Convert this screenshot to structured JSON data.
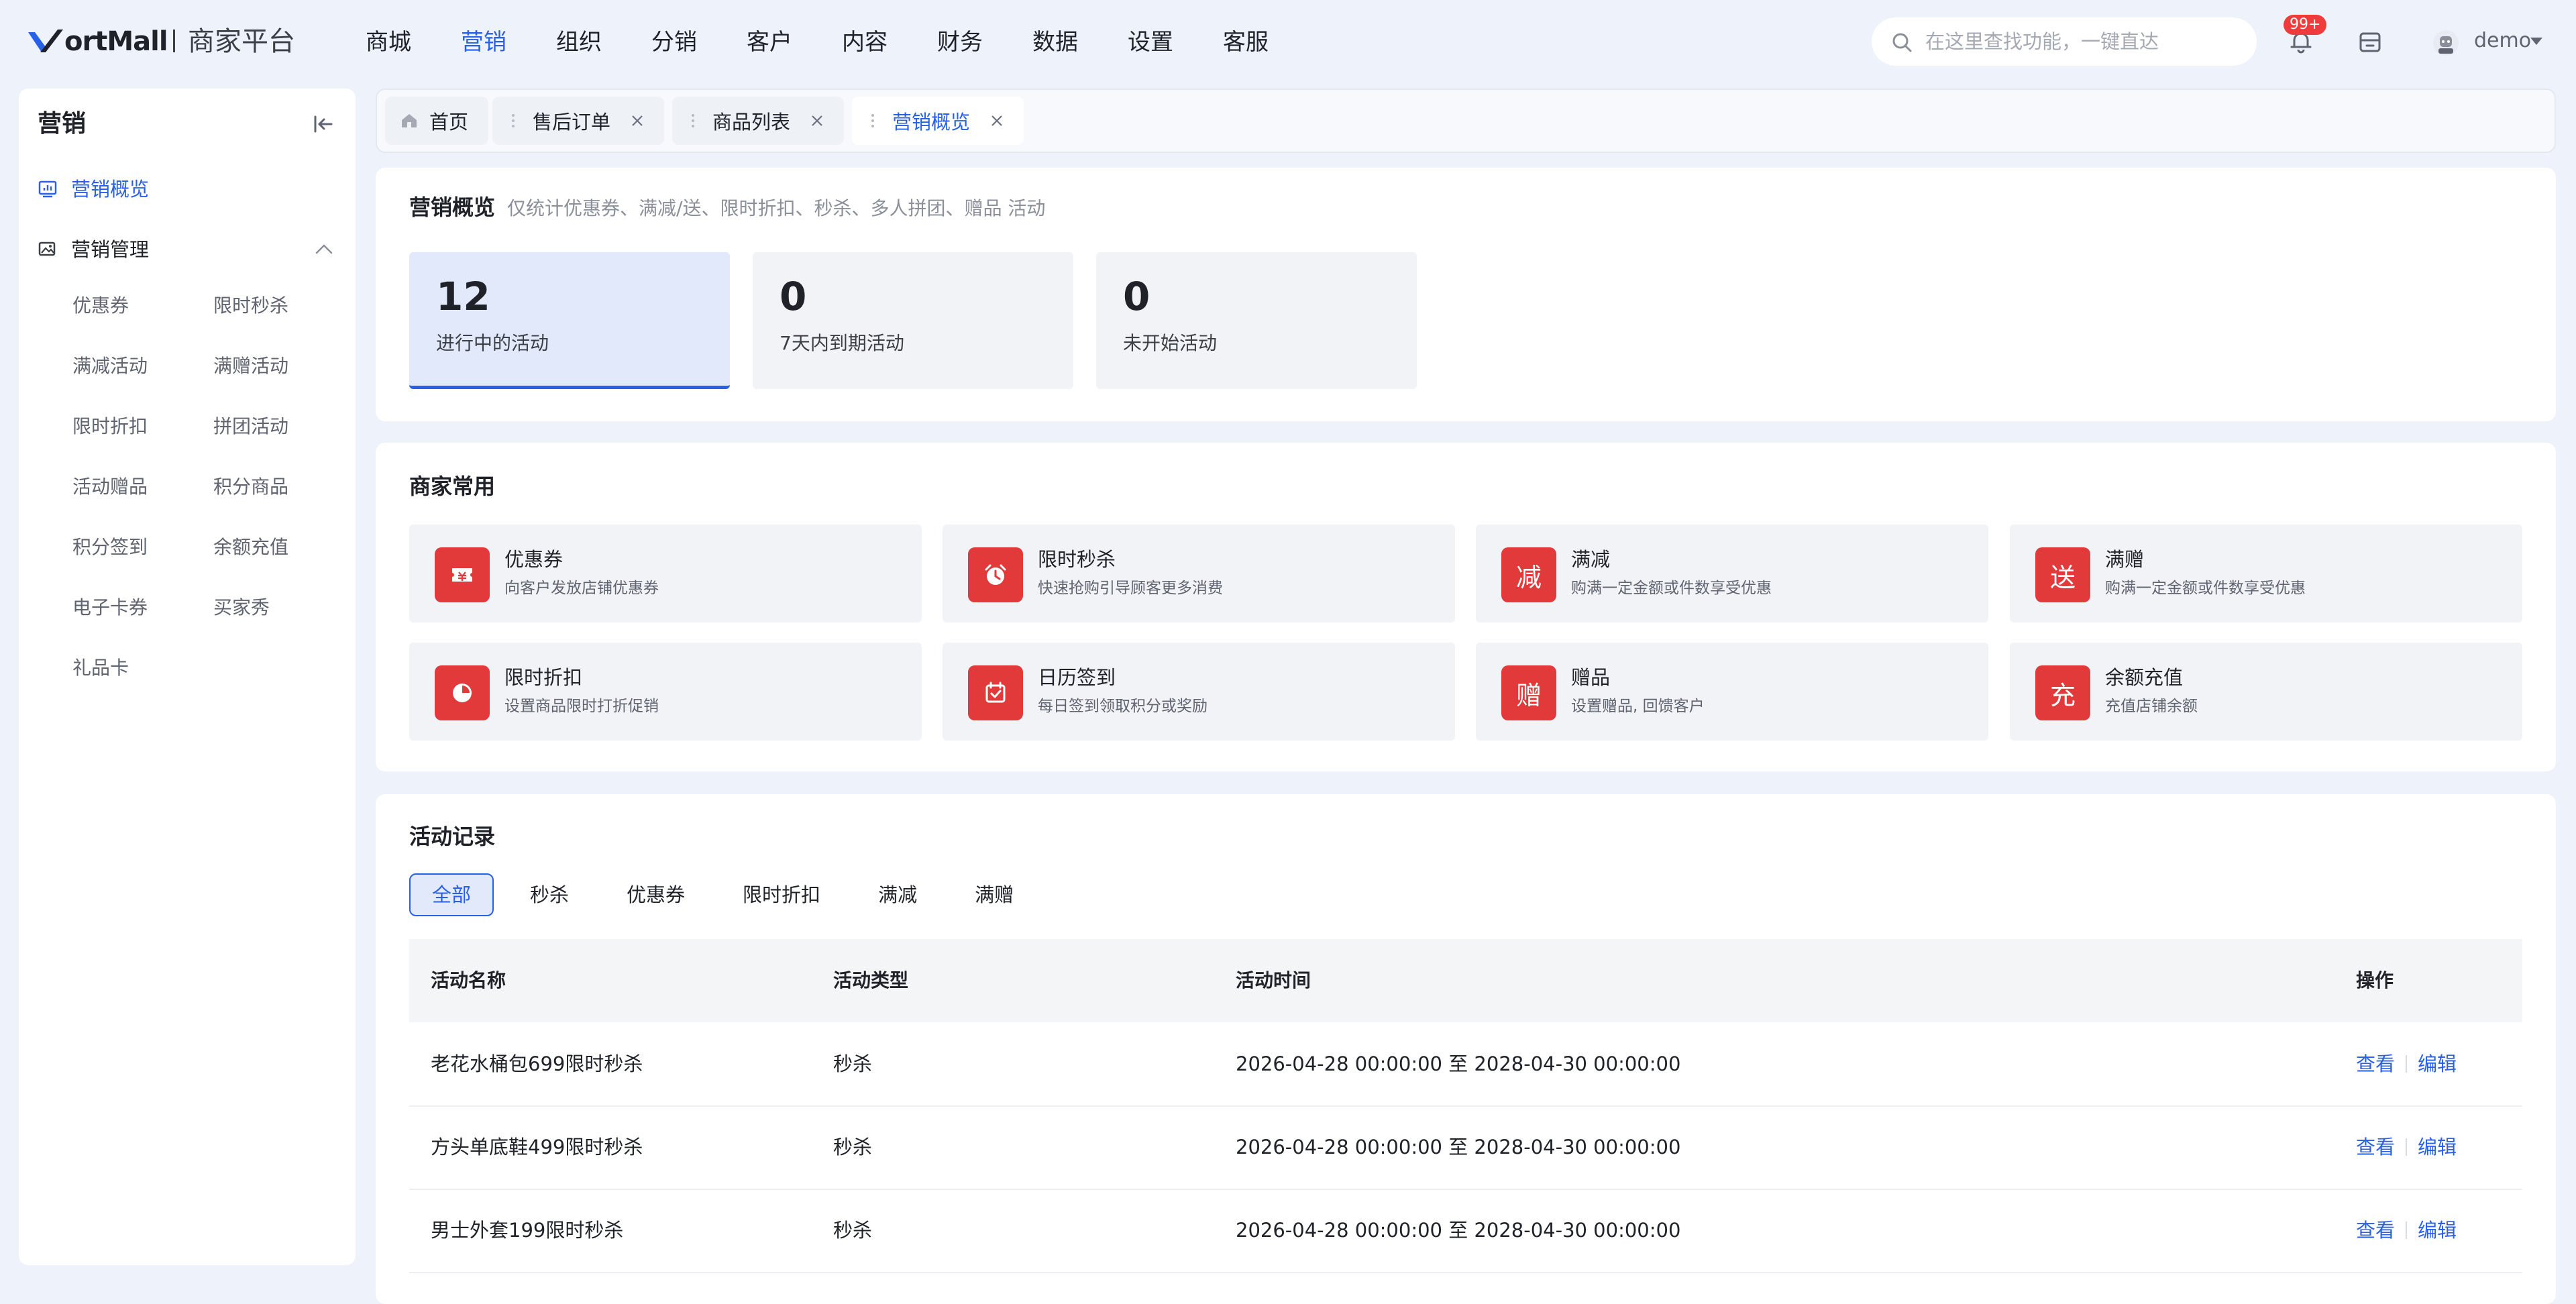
{
  "brand": {
    "name": "ortMall",
    "subtitle": "商家平台",
    "accent": "#2860e8"
  },
  "topnav": {
    "items": [
      {
        "label": "商城"
      },
      {
        "label": "营销",
        "active": true
      },
      {
        "label": "组织"
      },
      {
        "label": "分销"
      },
      {
        "label": "客户"
      },
      {
        "label": "内容"
      },
      {
        "label": "财务"
      },
      {
        "label": "数据"
      },
      {
        "label": "设置"
      },
      {
        "label": "客服"
      }
    ]
  },
  "search": {
    "placeholder": "在这里查找功能，一键直达",
    "icon": "search-icon"
  },
  "notifications": {
    "badge": "99+",
    "icon": "bell-icon"
  },
  "user": {
    "name": "demo"
  },
  "sidebar": {
    "title": "营销",
    "overview": "营销概览",
    "management": "营销管理",
    "sub_items": [
      "优惠券",
      "限时秒杀",
      "满减活动",
      "满赠活动",
      "限时折扣",
      "拼团活动",
      "活动赠品",
      "积分商品",
      "积分签到",
      "余额充值",
      "电子卡券",
      "买家秀",
      "礼品卡"
    ]
  },
  "tabs": [
    {
      "label": "首页",
      "home": true
    },
    {
      "label": "售后订单"
    },
    {
      "label": "商品列表"
    },
    {
      "label": "营销概览",
      "active": true
    }
  ],
  "overview": {
    "title": "营销概览",
    "subtitle": "仅统计优惠券、满减/送、限时折扣、秒杀、多人拼团、赠品 活动",
    "stats": [
      {
        "value": "12",
        "label": "进行中的活动",
        "active": true
      },
      {
        "value": "0",
        "label": "7天内到期活动"
      },
      {
        "value": "0",
        "label": "未开始活动"
      }
    ]
  },
  "common": {
    "title": "商家常用",
    "tiles": [
      {
        "name": "优惠券",
        "desc": "向客户发放店铺优惠券",
        "icon": "ticket-icon",
        "glyph": ""
      },
      {
        "name": "限时秒杀",
        "desc": "快速抢购引导顾客更多消费",
        "icon": "alarm-clock-icon",
        "glyph": ""
      },
      {
        "name": "满减",
        "desc": "购满一定金额或件数享受优惠",
        "icon": "text-badge-icon",
        "glyph": "减"
      },
      {
        "name": "满赠",
        "desc": "购满一定金额或件数享受优惠",
        "icon": "text-badge-icon",
        "glyph": "送"
      },
      {
        "name": "限时折扣",
        "desc": "设置商品限时打折促销",
        "icon": "discount-clock-icon",
        "glyph": ""
      },
      {
        "name": "日历签到",
        "desc": "每日签到领取积分或奖励",
        "icon": "calendar-check-icon",
        "glyph": ""
      },
      {
        "name": "赠品",
        "desc": "设置赠品, 回馈客户",
        "icon": "text-badge-icon",
        "glyph": "赠"
      },
      {
        "name": "余额充值",
        "desc": "充值店铺余额",
        "icon": "text-badge-icon",
        "glyph": "充"
      }
    ],
    "tile_color": "#e23a3a"
  },
  "records": {
    "title": "活动记录",
    "filters": [
      {
        "label": "全部",
        "active": true
      },
      {
        "label": "秒杀"
      },
      {
        "label": "优惠券"
      },
      {
        "label": "限时折扣"
      },
      {
        "label": "满减"
      },
      {
        "label": "满赠"
      }
    ],
    "columns": [
      "活动名称",
      "活动类型",
      "活动时间",
      "操作"
    ],
    "rows": [
      {
        "name": "老花水桶包699限时秒杀",
        "type": "秒杀",
        "time": "2026-04-28 00:00:00 至 2028-04-30 00:00:00"
      },
      {
        "name": "方头单底鞋499限时秒杀",
        "type": "秒杀",
        "time": "2026-04-28 00:00:00 至 2028-04-30 00:00:00"
      },
      {
        "name": "男士外套199限时秒杀",
        "type": "秒杀",
        "time": "2026-04-28 00:00:00 至 2028-04-30 00:00:00"
      }
    ],
    "actions": {
      "view": "查看",
      "edit": "编辑"
    }
  }
}
